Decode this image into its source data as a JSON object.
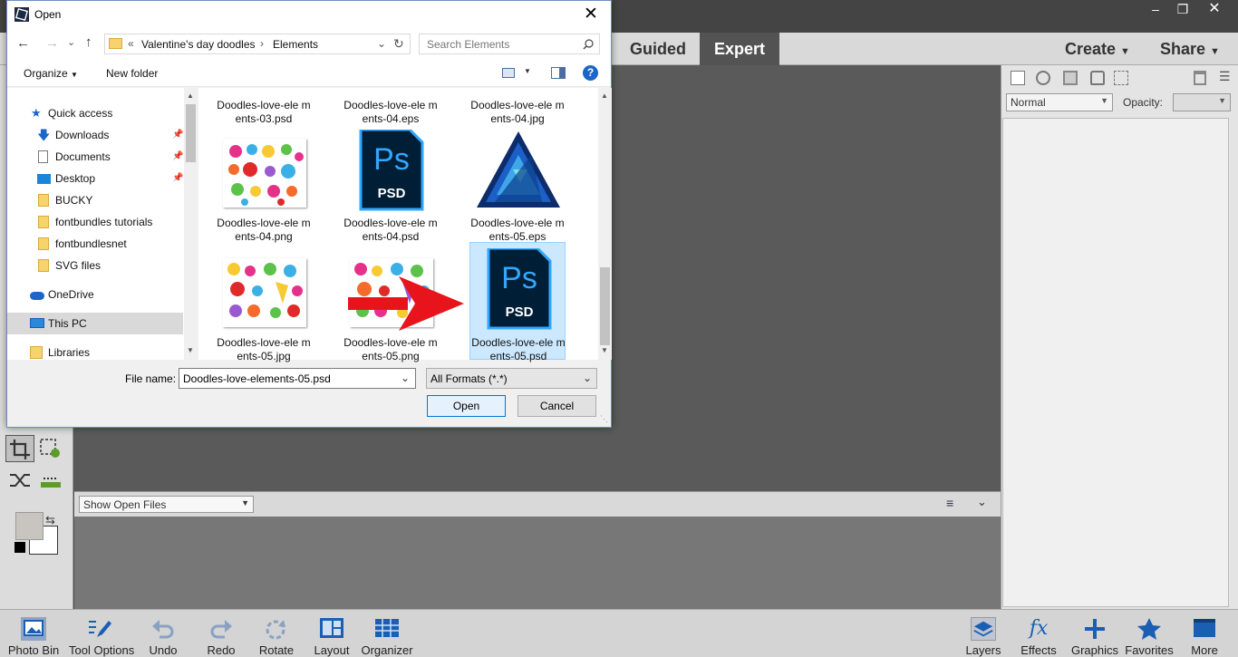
{
  "app": {
    "modes": {
      "guided": "Guided",
      "expert": "Expert"
    },
    "menus": {
      "create": "Create",
      "share": "Share"
    },
    "blend_mode": "Normal",
    "opacity_label": "Opacity:",
    "bin_dropdown": "Show Open Files",
    "bottom_tools": {
      "photo_bin": "Photo Bin",
      "tool_options": "Tool Options",
      "undo": "Undo",
      "redo": "Redo",
      "rotate": "Rotate",
      "layout": "Layout",
      "organizer": "Organizer",
      "layers": "Layers",
      "effects": "Effects",
      "graphics": "Graphics",
      "favorites": "Favorites",
      "more": "More"
    }
  },
  "dialog": {
    "title": "Open",
    "breadcrumb": {
      "overflow": "«",
      "parent": "Valentine's day doodles",
      "current": "Elements"
    },
    "search_placeholder": "Search Elements",
    "organize": "Organize",
    "new_folder": "New folder",
    "nav": {
      "quick_access": "Quick access",
      "downloads": "Downloads",
      "documents": "Documents",
      "desktop": "Desktop",
      "bucky": "BUCKY",
      "fontbundles_tutorials": "fontbundles tutorials",
      "fontbundlesnet": "fontbundlesnet",
      "svg_files": "SVG files",
      "onedrive": "OneDrive",
      "this_pc": "This PC",
      "libraries": "Libraries"
    },
    "files": [
      {
        "name": "Doodles-love-ele ments-03.psd"
      },
      {
        "name": "Doodles-love-ele ments-04.eps"
      },
      {
        "name": "Doodles-love-ele ments-04.jpg"
      },
      {
        "name": "Doodles-love-ele ments-04.png",
        "thumb": "doodle"
      },
      {
        "name": "Doodles-love-ele ments-04.psd",
        "thumb": "psd",
        "badge": "PSD",
        "logo": "Ps"
      },
      {
        "name": "Doodles-love-ele ments-05.eps",
        "thumb": "affinity"
      },
      {
        "name": "Doodles-love-ele ments-05.jpg",
        "thumb": "doodle"
      },
      {
        "name": "Doodles-love-ele ments-05.png",
        "thumb": "doodle"
      },
      {
        "name": "Doodles-love-ele ments-05.psd",
        "thumb": "psd",
        "badge": "PSD",
        "logo": "Ps",
        "selected": true
      }
    ],
    "file_name_label": "File name:",
    "file_name_value": "Doodles-love-elements-05.psd",
    "file_type": "All Formats (*.*)",
    "open_button": "Open",
    "cancel_button": "Cancel"
  },
  "colors": {
    "accent_blue": "#1a5fb4",
    "selection_bg": "#cce8ff",
    "arrow_red": "#e8141b",
    "psd_blue": "#31a8ff",
    "psd_bg": "#001e36"
  }
}
